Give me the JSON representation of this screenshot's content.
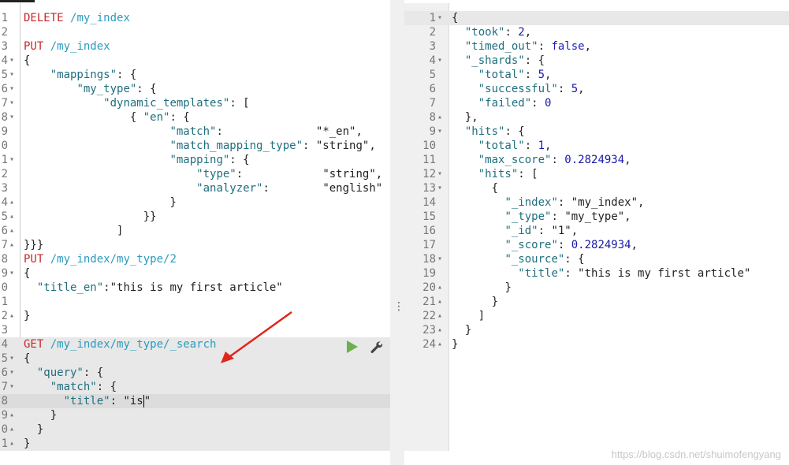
{
  "left_editor": {
    "lines": [
      {
        "num": "1",
        "html": "<span class='kw'>DELETE</span> <span class='url'>/my_index</span>"
      },
      {
        "num": "2",
        "html": ""
      },
      {
        "num": "3",
        "html": "<span class='kw'>PUT</span> <span class='url'>/my_index</span>"
      },
      {
        "num": "4",
        "fold": "▾",
        "html": "<span class='p'>{</span>"
      },
      {
        "num": "5",
        "fold": "▾",
        "html": "    <span class='t'>\"mappings\"</span><span class='p'>: {</span>"
      },
      {
        "num": "6",
        "fold": "▾",
        "html": "        <span class='t'>\"my_type\"</span><span class='p'>: {</span>"
      },
      {
        "num": "7",
        "fold": "▾",
        "html": "            <span class='t'>\"dynamic_templates\"</span><span class='p'>: [</span>"
      },
      {
        "num": "8",
        "fold": "▾",
        "html": "                <span class='p'>{ </span><span class='t'>\"en\"</span><span class='p'>: {</span>"
      },
      {
        "num": "9",
        "html": "                      <span class='t'>\"match\"</span><span class='p'>:              </span><span class='p'>\"*_en\"</span><span class='p'>,</span>"
      },
      {
        "num": "0",
        "html": "                      <span class='t'>\"match_mapping_type\"</span><span class='p'>: </span><span class='p'>\"string\"</span><span class='p'>,</span>"
      },
      {
        "num": "1",
        "fold": "▾",
        "html": "                      <span class='t'>\"mapping\"</span><span class='p'>: {</span>"
      },
      {
        "num": "2",
        "html": "                          <span class='t'>\"type\"</span><span class='p'>:            </span><span class='p'>\"string\"</span><span class='p'>,</span>"
      },
      {
        "num": "3",
        "html": "                          <span class='t'>\"analyzer\"</span><span class='p'>:        </span><span class='p'>\"english\"</span>"
      },
      {
        "num": "4",
        "fold": "▴",
        "html": "                      <span class='p'>}</span>"
      },
      {
        "num": "5",
        "fold": "▴",
        "html": "                  <span class='p'>}}</span>"
      },
      {
        "num": "6",
        "fold": "▴",
        "html": "              <span class='p'>]</span>"
      },
      {
        "num": "7",
        "fold": "▴",
        "html": "<span class='p'>}}}</span>"
      },
      {
        "num": "8",
        "html": "<span class='kw'>PUT</span> <span class='url'>/my_index/my_type/2</span>"
      },
      {
        "num": "9",
        "fold": "▾",
        "html": "<span class='p'>{</span>"
      },
      {
        "num": "0",
        "html": "  <span class='t'>\"title_en\"</span><span class='p'>:</span><span class='p'>\"this is my first article\"</span>"
      },
      {
        "num": "1",
        "html": ""
      },
      {
        "num": "2",
        "fold": "▴",
        "html": "<span class='p'>}</span>"
      },
      {
        "num": "3",
        "html": ""
      },
      {
        "num": "4",
        "hl": true,
        "html": "<span class='kw'>GET</span> <span class='url'>/my_index/my_type/_search</span>"
      },
      {
        "num": "5",
        "fold": "▾",
        "hl": true,
        "html": "<span class='p'>{</span>"
      },
      {
        "num": "6",
        "fold": "▾",
        "hl": true,
        "html": "  <span class='t'>\"query\"</span><span class='p'>: {</span>"
      },
      {
        "num": "7",
        "fold": "▾",
        "hl": true,
        "html": "    <span class='t'>\"match\"</span><span class='p'>: {</span>"
      },
      {
        "num": "8",
        "cursor": true,
        "html": "      <span class='t'>\"title\"</span><span class='p'>: </span><span class='p'>\"is</span><span class='caret'></span><span class='p'>\"</span>"
      },
      {
        "num": "9",
        "fold": "▴",
        "hl": true,
        "html": "    <span class='p'>}</span>"
      },
      {
        "num": "0",
        "fold": "▴",
        "hl": true,
        "html": "  <span class='p'>}</span>"
      },
      {
        "num": "1",
        "fold": "▴",
        "hl": true,
        "html": "<span class='p'>}</span>"
      }
    ]
  },
  "right_editor": {
    "lines": [
      {
        "num": "1",
        "fold": "▾",
        "hl": true,
        "html": "<span class='p'>{</span>"
      },
      {
        "num": "2",
        "html": "  <span class='t'>\"took\"</span><span class='p'>: </span><span class='n'>2</span><span class='p'>,</span>"
      },
      {
        "num": "3",
        "html": "  <span class='t'>\"timed_out\"</span><span class='p'>: </span><span class='b'>false</span><span class='p'>,</span>"
      },
      {
        "num": "4",
        "fold": "▾",
        "html": "  <span class='t'>\"_shards\"</span><span class='p'>: {</span>"
      },
      {
        "num": "5",
        "html": "    <span class='t'>\"total\"</span><span class='p'>: </span><span class='n'>5</span><span class='p'>,</span>"
      },
      {
        "num": "6",
        "html": "    <span class='t'>\"successful\"</span><span class='p'>: </span><span class='n'>5</span><span class='p'>,</span>"
      },
      {
        "num": "7",
        "html": "    <span class='t'>\"failed\"</span><span class='p'>: </span><span class='n'>0</span>"
      },
      {
        "num": "8",
        "fold": "▴",
        "html": "  <span class='p'>},</span>"
      },
      {
        "num": "9",
        "fold": "▾",
        "html": "  <span class='t'>\"hits\"</span><span class='p'>: {</span>"
      },
      {
        "num": "10",
        "html": "    <span class='t'>\"total\"</span><span class='p'>: </span><span class='n'>1</span><span class='p'>,</span>"
      },
      {
        "num": "11",
        "html": "    <span class='t'>\"max_score\"</span><span class='p'>: </span><span class='n'>0.2824934</span><span class='p'>,</span>"
      },
      {
        "num": "12",
        "fold": "▾",
        "html": "    <span class='t'>\"hits\"</span><span class='p'>: [</span>"
      },
      {
        "num": "13",
        "fold": "▾",
        "html": "      <span class='p'>{</span>"
      },
      {
        "num": "14",
        "html": "        <span class='t'>\"_index\"</span><span class='p'>: </span><span class='p'>\"my_index\"</span><span class='p'>,</span>"
      },
      {
        "num": "15",
        "html": "        <span class='t'>\"_type\"</span><span class='p'>: </span><span class='p'>\"my_type\"</span><span class='p'>,</span>"
      },
      {
        "num": "16",
        "html": "        <span class='t'>\"_id\"</span><span class='p'>: </span><span class='p'>\"1\"</span><span class='p'>,</span>"
      },
      {
        "num": "17",
        "html": "        <span class='t'>\"_score\"</span><span class='p'>: </span><span class='n'>0.2824934</span><span class='p'>,</span>"
      },
      {
        "num": "18",
        "fold": "▾",
        "html": "        <span class='t'>\"_source\"</span><span class='p'>: {</span>"
      },
      {
        "num": "19",
        "html": "          <span class='t'>\"title\"</span><span class='p'>: </span><span class='p'>\"this is my first article\"</span>"
      },
      {
        "num": "20",
        "fold": "▴",
        "html": "        <span class='p'>}</span>"
      },
      {
        "num": "21",
        "fold": "▴",
        "html": "      <span class='p'>}</span>"
      },
      {
        "num": "22",
        "fold": "▴",
        "html": "    <span class='p'>]</span>"
      },
      {
        "num": "23",
        "fold": "▴",
        "html": "  <span class='p'>}</span>"
      },
      {
        "num": "24",
        "fold": "▴",
        "html": "<span class='p'>}</span>"
      }
    ]
  },
  "splitter": {
    "handle": "⋮"
  },
  "watermark": "https://blog.csdn.net/shuimofengyang",
  "icons": {
    "run": "play-icon",
    "settings": "wrench-icon"
  },
  "colors": {
    "key": "#1f6f7e",
    "method": "#c62828",
    "url": "#2a9bbf",
    "number": "#1a1aa6",
    "run": "#6ab04c",
    "arrow": "#e0251b"
  }
}
